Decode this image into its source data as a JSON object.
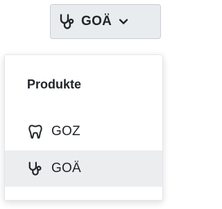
{
  "trigger": {
    "label": "GOÄ",
    "icon": "stethoscope-icon",
    "caret_icon": "chevron-down-icon"
  },
  "menu": {
    "header": "Produkte",
    "items": [
      {
        "label": "GOZ",
        "icon": "tooth-icon",
        "highlighted": false
      },
      {
        "label": "GOÄ",
        "icon": "stethoscope-icon",
        "highlighted": true
      }
    ]
  },
  "colors": {
    "button_bg": "#e9ecef",
    "highlight_bg": "#ebedef",
    "text": "#212529"
  }
}
